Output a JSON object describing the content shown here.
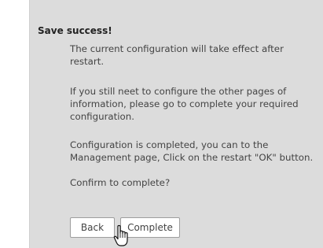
{
  "dialog": {
    "title": "Save success!",
    "messages": [
      "The current configuration will take effect after restart.",
      "If you still neet to configure the other pages of information, please go to complete your required configuration.",
      "Configuration is completed, you can to the Management page, Click on the restart \"OK\" button.",
      "Confirm to complete?"
    ],
    "buttons": {
      "back": "Back",
      "complete": "Complete"
    }
  },
  "colors": {
    "dialog_bg": "#dcdcdc",
    "text": "#444444",
    "button_border": "#9d9d9d"
  },
  "cursor": {
    "icon": "hand-pointer-icon"
  }
}
